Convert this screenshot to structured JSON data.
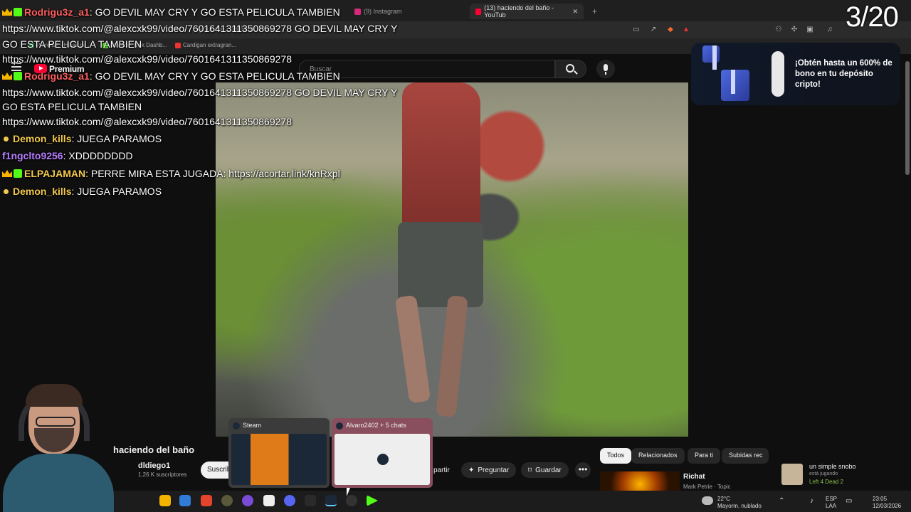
{
  "browser": {
    "tabs": [
      {
        "label": "(9) Instagram"
      },
      {
        "label": "(13) haciendo del baño - YouTub"
      }
    ],
    "url": "youtube.com/watch?v=...",
    "bookmarks": [
      "Perreitsx - Hojas de...",
      "Stream - Kick Dashb...",
      "Cardigan extragran..."
    ]
  },
  "youtube": {
    "premium": "Premium",
    "search_placeholder": "Buscar",
    "video_title": "haciendo del baño",
    "channel": "dldiego1",
    "subscribers": "1,26 K suscriptores",
    "subscribe": "Suscrib",
    "share": "partir",
    "ask": "Preguntar",
    "save": "Guardar",
    "more": "•••",
    "chips": [
      "Todos",
      "Relacionados",
      "Para ti",
      "Subidas rec"
    ],
    "related_title": "Richat",
    "related_channel": "Mark Petrie · Topic"
  },
  "ad": {
    "text": "¡Obtén hasta un 600% de bono en tu depósito cripto!"
  },
  "overlay": {
    "counter": "3/20",
    "chat": [
      {
        "user": "Rodrigu3z_a1",
        "text": ": GO DEVIL MAY CRY Y GO ESTA PELICULA TAMBIEN",
        "color": "#ff5f5f",
        "badge": "crown"
      },
      {
        "user": "",
        "text": "https://www.tiktok.com/@alexcxk99/video/7601641311350869278 GO DEVIL MAY CRY Y",
        "color": "#ffffff",
        "badge": ""
      },
      {
        "user": "",
        "text": "GO ESTA PELICULA TAMBIEN",
        "color": "#ffffff",
        "badge": ""
      },
      {
        "user": "",
        "text": "https://www.tiktok.com/@alexcxk99/video/7601641311350869278",
        "color": "#ffffff",
        "badge": ""
      },
      {
        "user": "Rodrigu3z_a1",
        "text": ": GO DEVIL MAY CRY Y GO ESTA PELICULA TAMBIEN",
        "color": "#ff5f5f",
        "badge": "crown"
      },
      {
        "user": "",
        "text": "https://www.tiktok.com/@alexcxk99/video/7601641311350869278 GO DEVIL MAY CRY Y",
        "color": "#ffffff",
        "badge": ""
      },
      {
        "user": "",
        "text": "GO ESTA PELICULA TAMBIEN",
        "color": "#ffffff",
        "badge": ""
      },
      {
        "user": "",
        "text": "https://www.tiktok.com/@alexcxk99/video/7601641311350869278",
        "color": "#ffffff",
        "badge": ""
      },
      {
        "user": "Demon_kills",
        "text": ": JUEGA PARAMOS",
        "color": "#f2c94c",
        "badge": "dot"
      },
      {
        "user": "f1ngclto9256",
        "text": ": XDDDDDDDD",
        "color": "#b77dff",
        "badge": ""
      },
      {
        "user": "ELPAJAMAN",
        "text": ": PERRE MIRA ESTA JUGADA: https://acortar.link/knRxpl",
        "color": "#f2c94c",
        "badge": "crown"
      },
      {
        "user": "Demon_kills",
        "text": ": JUEGA PARAMOS",
        "color": "#f2c94c",
        "badge": "dot"
      }
    ]
  },
  "taskbar": {
    "preview_steam": "Steam",
    "preview_chat": "Alvaro2402 + 5 chats",
    "friend_name": "un simple snobo",
    "friend_status": "está jugando",
    "friend_game": "Left 4 Dead 2",
    "weather_temp": "22°C",
    "weather_desc": "Mayorm. nublado",
    "lang": "ESP",
    "lang2": "LAA",
    "time": "23:05",
    "date": "12/03/2026"
  },
  "colors": {
    "accent_red": "#ff0033",
    "kick_green": "#53fc18"
  }
}
